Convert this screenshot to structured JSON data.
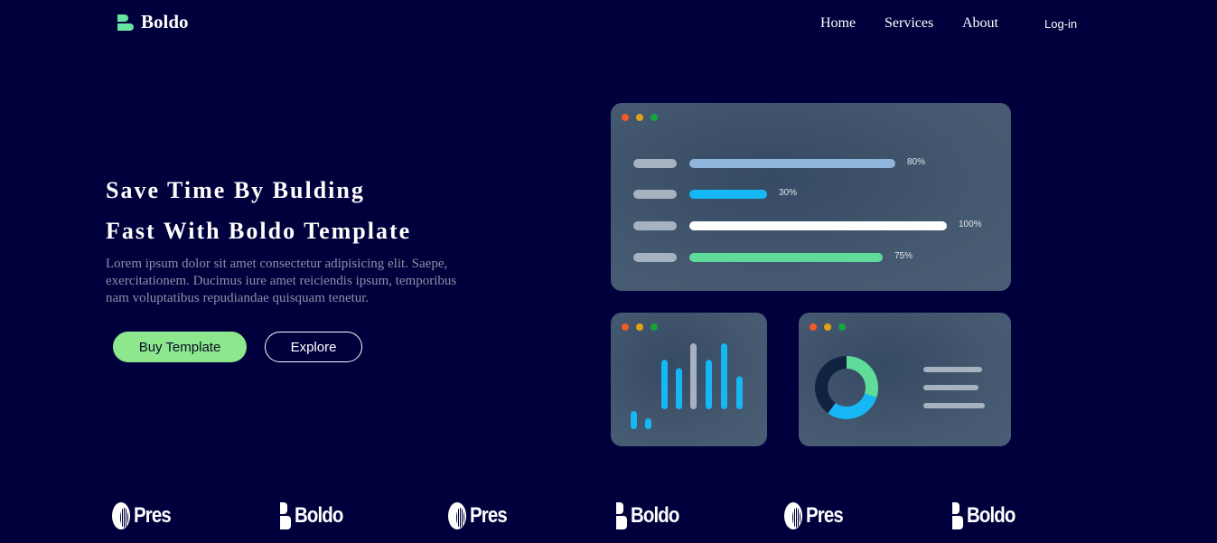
{
  "header": {
    "brand": "Boldo",
    "nav": {
      "home": "Home",
      "services": "Services",
      "about": "About",
      "login": "Log-in"
    }
  },
  "hero": {
    "title_line1": "Save Time By Bulding",
    "title_line2": "Fast With Boldo Template",
    "description": "Lorem ipsum dolor sit amet consectetur adipisicing elit. Saepe, exercitationem. Ducimus iure amet reiciendis ipsum, temporibus nam voluptatibus repudiandae quisquam tenetur.",
    "buy_button": "Buy Template",
    "explore_button": "Explore"
  },
  "dashboard": {
    "progress": [
      {
        "percent_label": "80%",
        "value": 80,
        "color": "#8fb6da"
      },
      {
        "percent_label": "30%",
        "value": 30,
        "color": "#16b7f5"
      },
      {
        "percent_label": "100%",
        "value": 100,
        "color": "#ffffff"
      },
      {
        "percent_label": "75%",
        "value": 75,
        "color": "#5fdc9a"
      }
    ],
    "bar_chart": {
      "values": [
        1,
        1,
        3,
        2.5,
        4,
        3,
        4,
        2
      ],
      "colors": [
        "#16b7f5",
        "#16b7f5",
        "#16b7f5",
        "#16b7f5",
        "#a7b2c0",
        "#16b7f5",
        "#16b7f5",
        "#16b7f5"
      ]
    },
    "donut": {
      "segments": [
        {
          "value": 30,
          "color": "#5fdc9a"
        },
        {
          "value": 30,
          "color": "#16b7f5"
        },
        {
          "value": 40,
          "color": "#0f2340"
        }
      ]
    },
    "colors": {
      "accent_green": "#5fdc9a",
      "accent_blue": "#16b7f5"
    }
  },
  "partners": [
    {
      "name": "Pres",
      "icon": "pres-logo-icon"
    },
    {
      "name": "Boldo",
      "icon": "boldo-logo-icon"
    },
    {
      "name": "Pres",
      "icon": "pres-logo-icon"
    },
    {
      "name": "Boldo",
      "icon": "boldo-logo-icon"
    },
    {
      "name": "Pres",
      "icon": "pres-logo-icon"
    },
    {
      "name": "Boldo",
      "icon": "boldo-logo-icon"
    }
  ],
  "colors": {
    "background": "#00003c",
    "buy_button": "#8de78c",
    "logo_accent": "#65e4a3"
  }
}
